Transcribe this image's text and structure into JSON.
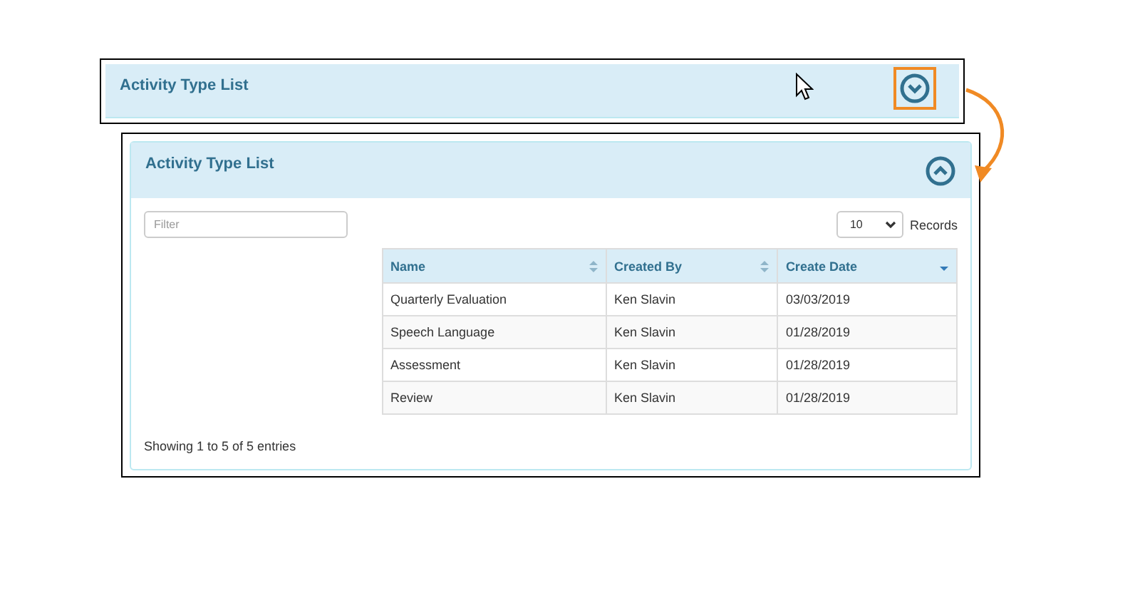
{
  "collapsed_panel": {
    "title": "Activity Type List",
    "expanded": false,
    "toggle_highlighted": true
  },
  "expanded_panel": {
    "title": "Activity Type List",
    "expanded": true,
    "filter": {
      "placeholder": "Filter"
    },
    "page_size": {
      "value": "10",
      "label": "Records"
    },
    "table": {
      "columns": [
        {
          "label": "Name",
          "sorted": false
        },
        {
          "label": "Created By",
          "sorted": false
        },
        {
          "label": "Create Date",
          "sorted": true
        }
      ],
      "rows": [
        [
          "Quarterly Evaluation",
          "Ken Slavin",
          "03/03/2019"
        ],
        [
          "Speech Language",
          "Ken Slavin",
          "01/28/2019"
        ],
        [
          "Assessment",
          "Ken Slavin",
          "01/28/2019"
        ],
        [
          "Review",
          "Ken Slavin",
          "01/28/2019"
        ]
      ]
    },
    "footer": "Showing 1 to 5 of 5 entries"
  }
}
